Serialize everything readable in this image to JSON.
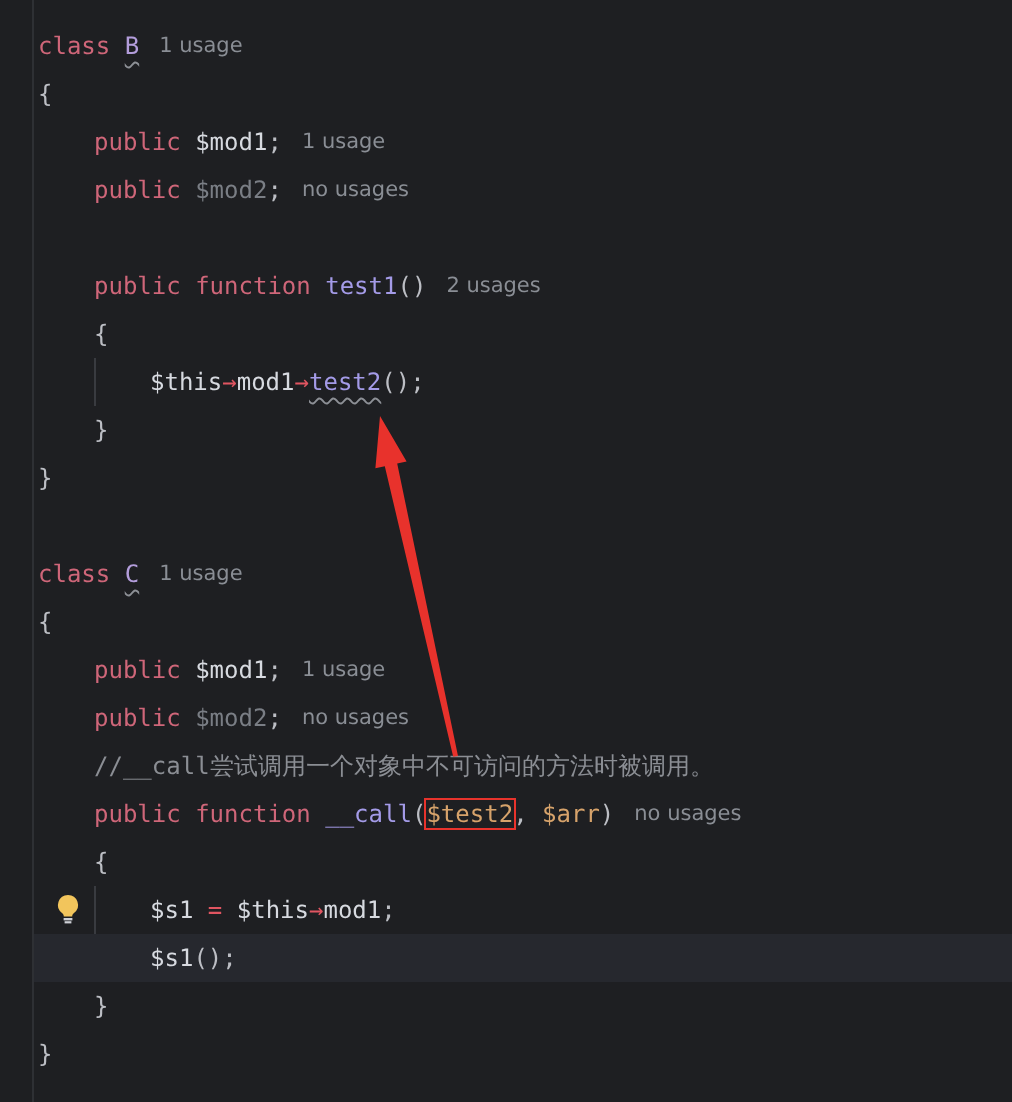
{
  "editor": {
    "lines": [
      {
        "kind": "code",
        "tokens": [
          {
            "kind": "keyword",
            "text": "class "
          },
          {
            "kind": "class-name",
            "text": "B",
            "squiggle": true
          }
        ],
        "hint": "1 usage"
      },
      {
        "kind": "code",
        "tokens": [
          {
            "kind": "brace",
            "text": "{"
          }
        ],
        "children": [
          {
            "kind": "code",
            "tokens": [
              {
                "kind": "keyword",
                "text": "public "
              },
              {
                "kind": "field",
                "text": "$mod1"
              },
              {
                "kind": "punct",
                "text": ";"
              }
            ],
            "hint": "1 usage"
          },
          {
            "kind": "code",
            "tokens": [
              {
                "kind": "keyword",
                "text": "public "
              },
              {
                "kind": "field-unused",
                "text": "$mod2"
              },
              {
                "kind": "punct",
                "text": ";"
              }
            ],
            "hint": "no usages"
          },
          {
            "kind": "blank"
          },
          {
            "kind": "code",
            "tokens": [
              {
                "kind": "keyword",
                "text": "public "
              },
              {
                "kind": "keyword",
                "text": "function "
              },
              {
                "kind": "function",
                "text": "test1"
              },
              {
                "kind": "punct",
                "text": "()"
              }
            ],
            "hint": "2 usages"
          },
          {
            "kind": "code",
            "tokens": [
              {
                "kind": "brace",
                "text": "{"
              }
            ],
            "children": [
              {
                "kind": "code",
                "tokens": [
                  {
                    "kind": "variable",
                    "text": "$this"
                  },
                  {
                    "kind": "arrow",
                    "text": "→"
                  },
                  {
                    "kind": "property",
                    "text": "mod1"
                  },
                  {
                    "kind": "arrow",
                    "text": "→"
                  },
                  {
                    "kind": "function",
                    "text": "test2",
                    "squiggle": true
                  },
                  {
                    "kind": "punct",
                    "text": "();"
                  }
                ]
              }
            ]
          },
          {
            "kind": "code",
            "tokens": [
              {
                "kind": "brace",
                "text": "}"
              }
            ]
          }
        ]
      },
      {
        "kind": "code",
        "tokens": [
          {
            "kind": "brace",
            "text": "}"
          }
        ]
      },
      {
        "kind": "blank"
      },
      {
        "kind": "code",
        "tokens": [
          {
            "kind": "keyword",
            "text": "class "
          },
          {
            "kind": "class-name",
            "text": "C",
            "squiggle": true
          }
        ],
        "hint": "1 usage"
      },
      {
        "kind": "code",
        "tokens": [
          {
            "kind": "brace",
            "text": "{"
          }
        ],
        "children": [
          {
            "kind": "code",
            "tokens": [
              {
                "kind": "keyword",
                "text": "public "
              },
              {
                "kind": "field",
                "text": "$mod1"
              },
              {
                "kind": "punct",
                "text": ";"
              }
            ],
            "hint": "1 usage"
          },
          {
            "kind": "code",
            "tokens": [
              {
                "kind": "keyword",
                "text": "public "
              },
              {
                "kind": "field-unused",
                "text": "$mod2"
              },
              {
                "kind": "punct",
                "text": ";"
              }
            ],
            "hint": "no usages"
          },
          {
            "kind": "code",
            "tokens": [
              {
                "kind": "comment",
                "text": "//__call尝试调用一个对象中不可访问的方法时被调用。"
              }
            ]
          },
          {
            "kind": "code",
            "tokens": [
              {
                "kind": "keyword",
                "text": "public "
              },
              {
                "kind": "keyword",
                "text": "function "
              },
              {
                "kind": "function",
                "text": "__call"
              },
              {
                "kind": "punct",
                "text": "("
              },
              {
                "kind": "param",
                "text": "$test2",
                "boxed": true
              },
              {
                "kind": "punct",
                "text": ", "
              },
              {
                "kind": "param",
                "text": "$arr"
              },
              {
                "kind": "punct",
                "text": ")"
              }
            ],
            "hint": "no usages"
          },
          {
            "kind": "code",
            "tokens": [
              {
                "kind": "brace",
                "text": "{"
              }
            ],
            "children": [
              {
                "kind": "code",
                "bulb": true,
                "tokens": [
                  {
                    "kind": "variable",
                    "text": "$s1"
                  },
                  {
                    "kind": "operator",
                    "text": " = "
                  },
                  {
                    "kind": "variable",
                    "text": "$this"
                  },
                  {
                    "kind": "arrow",
                    "text": "→"
                  },
                  {
                    "kind": "property",
                    "text": "mod1"
                  },
                  {
                    "kind": "punct",
                    "text": ";"
                  }
                ]
              },
              {
                "kind": "code",
                "current": true,
                "tokens": [
                  {
                    "kind": "variable",
                    "text": "$s1"
                  },
                  {
                    "kind": "punct",
                    "text": "();"
                  }
                ]
              }
            ]
          },
          {
            "kind": "code",
            "tokens": [
              {
                "kind": "brace",
                "text": "}"
              }
            ]
          }
        ]
      },
      {
        "kind": "code",
        "tokens": [
          {
            "kind": "brace",
            "text": "}"
          }
        ]
      }
    ]
  }
}
